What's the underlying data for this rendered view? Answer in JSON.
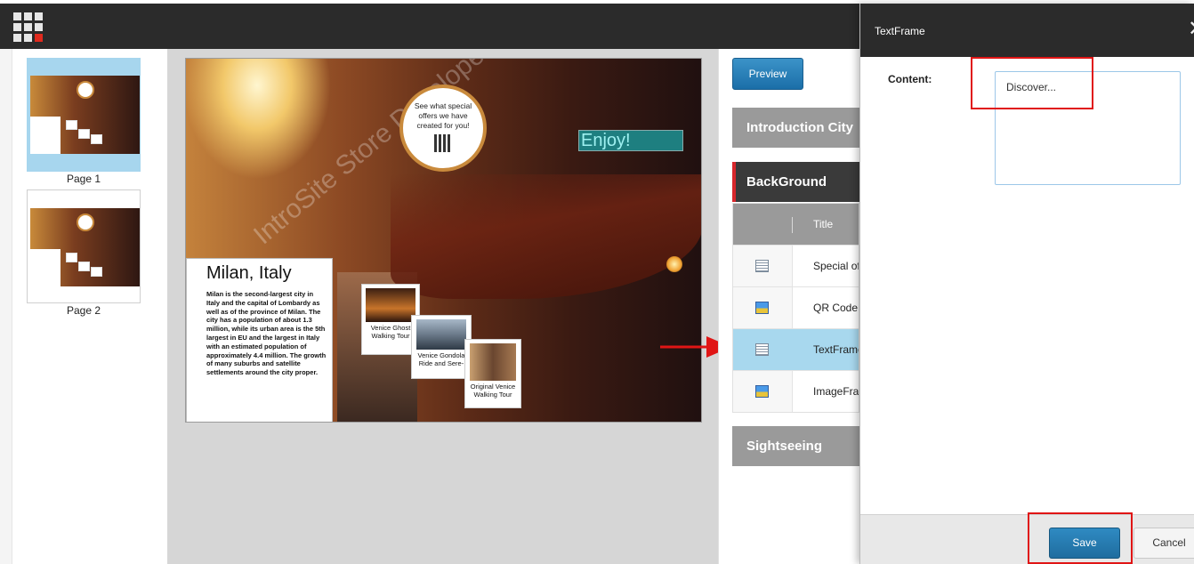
{
  "pages": [
    {
      "label": "Page 1",
      "mini_text": "Enjoy!",
      "mini_title": "Milan, Italy"
    },
    {
      "label": "Page 2",
      "mini_text": "Discover...",
      "mini_title": "Venice, Italy"
    }
  ],
  "canvas": {
    "watermark": "IntroSite Store Developer Edition",
    "offer_text": "See what special offers we have created for you!",
    "enjoy_text": "Enjoy!",
    "city_title": "Milan, Italy",
    "city_body": "Milan is the second-largest city in Italy and the capital of Lombardy as well as of the province of Milan. The city has a population of about 1.3 million, while its urban area is the 5th largest in EU and the largest in Italy with an estimated population of approximately 4.4 million. The growth of many suburbs and satellite settlements around the city proper.",
    "photos": [
      {
        "caption": "Venice Ghost Walking Tour"
      },
      {
        "caption": "Venice Gondola Ride and Sere-"
      },
      {
        "caption": "Original Venice Walking Tour"
      }
    ]
  },
  "panel": {
    "preview_label": "Preview",
    "sections": [
      "Introduction City",
      "BackGround",
      "Sightseeing"
    ],
    "column_title": "Title",
    "rows": [
      {
        "label": "Special of",
        "icon": "text-frame-icon"
      },
      {
        "label": "QR Code",
        "icon": "image-frame-icon"
      },
      {
        "label": "TextFrame",
        "icon": "text-frame-icon"
      },
      {
        "label": "ImageFra",
        "icon": "image-frame-icon"
      }
    ]
  },
  "dialog": {
    "title": "TextFrame",
    "close_glyph": "✕",
    "content_label": "Content:",
    "content_value": "Discover...",
    "save_label": "Save",
    "cancel_label": "Cancel"
  },
  "colors": {
    "accent_blue": "#1f6d9f",
    "highlight_red": "#e01515",
    "selected_row": "#a8d8ee"
  }
}
